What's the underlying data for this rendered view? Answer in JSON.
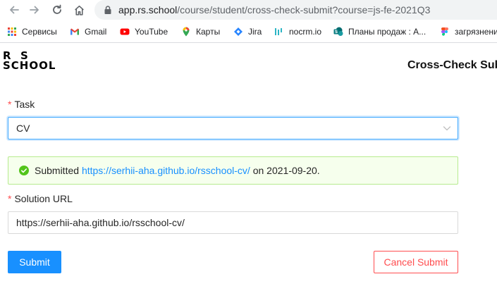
{
  "browser": {
    "url_host": "app.rs.school",
    "url_path": "/course/student/cross-check-submit?course=js-fe-2021Q3",
    "bookmarks": [
      {
        "label": "Сервисы",
        "icon": "apps-grid-icon"
      },
      {
        "label": "Gmail",
        "icon": "gmail-icon"
      },
      {
        "label": "YouTube",
        "icon": "youtube-icon"
      },
      {
        "label": "Карты",
        "icon": "maps-pin-icon"
      },
      {
        "label": "Jira",
        "icon": "jira-icon"
      },
      {
        "label": "nocrm.io",
        "icon": "nocrm-icon"
      },
      {
        "label": "Планы продаж : А...",
        "icon": "sharepoint-icon"
      },
      {
        "label": "загрязнени",
        "icon": "figma-icon"
      }
    ]
  },
  "header": {
    "logo_line1": "R  S",
    "logo_line2": "SCHOOL",
    "title": "Cross-Check Sub"
  },
  "form": {
    "task_label": "Task",
    "task_value": "CV",
    "alert": {
      "prefix": "Submitted ",
      "link": "https://serhii-aha.github.io/rsschool-cv/",
      "suffix": " on 2021-09-20."
    },
    "solution_label": "Solution URL",
    "solution_value": "https://serhii-aha.github.io/rsschool-cv/",
    "submit_label": "Submit",
    "cancel_label": "Cancel Submit"
  },
  "colors": {
    "primary": "#1890ff",
    "danger": "#ff4d4f",
    "success_bg": "#f6ffed",
    "success_border": "#b7eb8f",
    "success_icon": "#52c41a"
  }
}
